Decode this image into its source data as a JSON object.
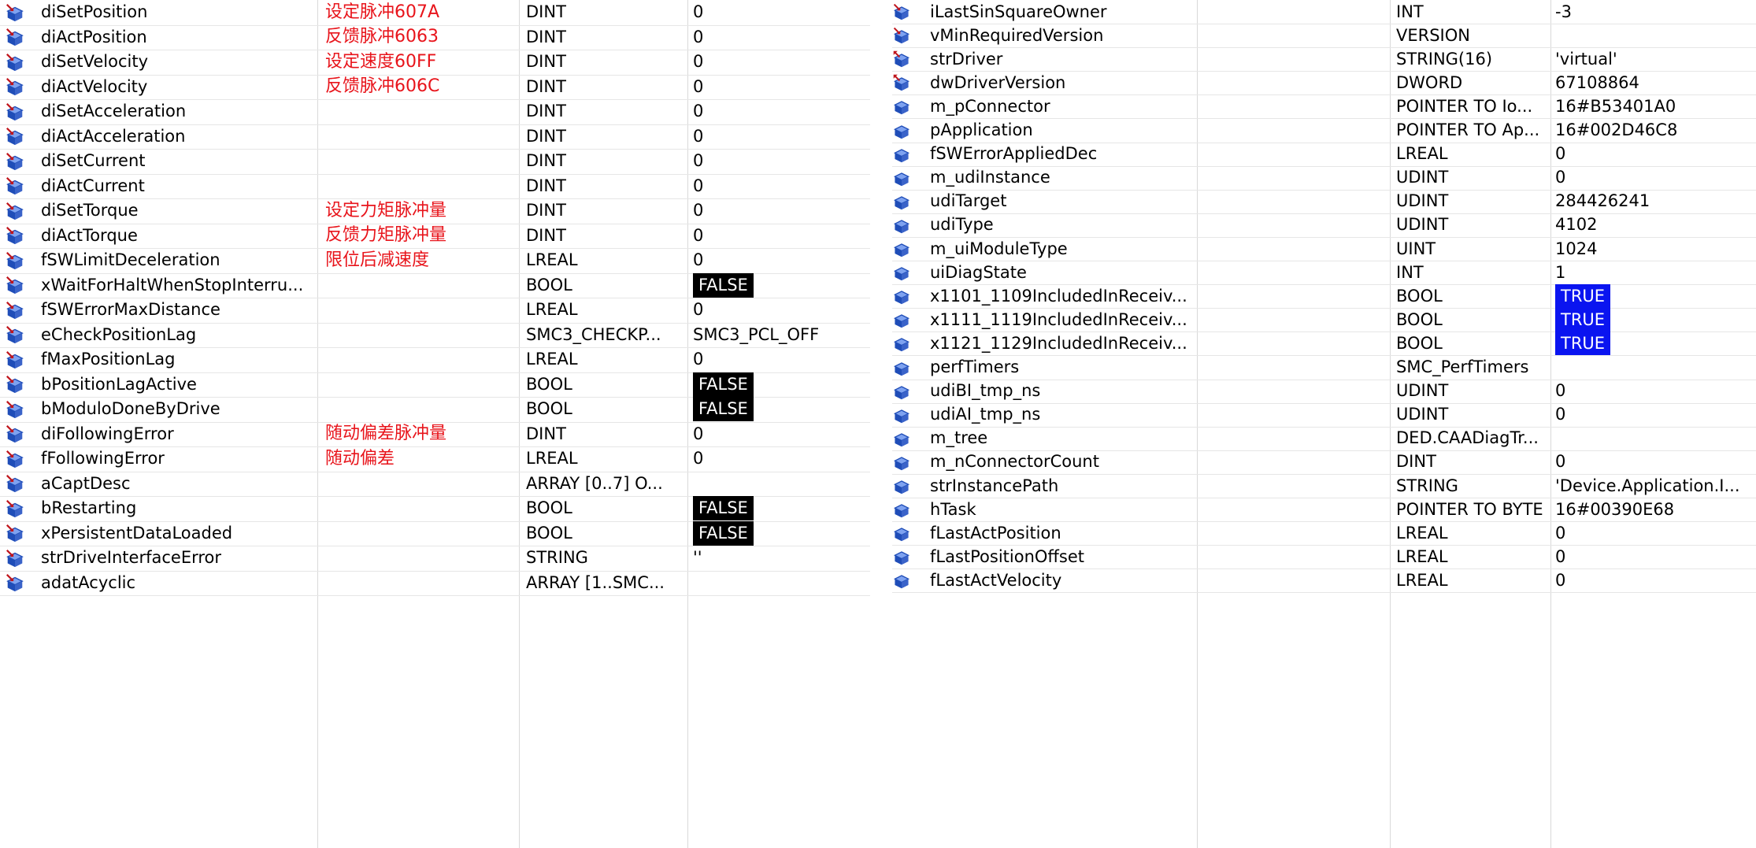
{
  "left_table": {
    "rows": [
      {
        "name": "diSetPosition",
        "note": "设定脉冲607A",
        "type": "DINT",
        "value": "0",
        "icon": "input-var-icon"
      },
      {
        "name": "diActPosition",
        "note": "反馈脉冲6063",
        "type": "DINT",
        "value": "0",
        "icon": "input-var-icon"
      },
      {
        "name": "diSetVelocity",
        "note": "设定速度60FF",
        "type": "DINT",
        "value": "0",
        "icon": "input-var-icon"
      },
      {
        "name": "diActVelocity",
        "note": "反馈脉冲606C",
        "type": "DINT",
        "value": "0",
        "icon": "input-var-icon"
      },
      {
        "name": "diSetAcceleration",
        "note": "",
        "type": "DINT",
        "value": "0",
        "icon": "input-var-icon"
      },
      {
        "name": "diActAcceleration",
        "note": "",
        "type": "DINT",
        "value": "0",
        "icon": "input-var-icon"
      },
      {
        "name": "diSetCurrent",
        "note": "",
        "type": "DINT",
        "value": "0",
        "icon": "input-var-icon"
      },
      {
        "name": "diActCurrent",
        "note": "",
        "type": "DINT",
        "value": "0",
        "icon": "input-var-icon"
      },
      {
        "name": "diSetTorque",
        "note": "设定力矩脉冲量",
        "type": "DINT",
        "value": "0",
        "icon": "input-var-icon"
      },
      {
        "name": "diActTorque",
        "note": "反馈力矩脉冲量",
        "type": "DINT",
        "value": "0",
        "icon": "input-var-icon"
      },
      {
        "name": "fSWLimitDeceleration",
        "note": "限位后减速度",
        "type": "LREAL",
        "value": "0",
        "icon": "input-var-icon"
      },
      {
        "name": "xWaitForHaltWhenStopInterru...",
        "note": "",
        "type": "BOOL",
        "value": "FALSE",
        "badge": "false",
        "icon": "input-var-icon"
      },
      {
        "name": "fSWErrorMaxDistance",
        "note": "",
        "type": "LREAL",
        "value": "0",
        "icon": "input-var-icon"
      },
      {
        "name": "eCheckPositionLag",
        "note": "",
        "type": "SMC3_CHECKP...",
        "value": "SMC3_PCL_OFF",
        "icon": "input-var-icon"
      },
      {
        "name": "fMaxPositionLag",
        "note": "",
        "type": "LREAL",
        "value": "0",
        "icon": "input-var-icon"
      },
      {
        "name": "bPositionLagActive",
        "note": "",
        "type": "BOOL",
        "value": "FALSE",
        "badge": "false",
        "icon": "input-var-icon"
      },
      {
        "name": "bModuloDoneByDrive",
        "note": "",
        "type": "BOOL",
        "value": "FALSE",
        "badge": "false",
        "icon": "input-var-icon"
      },
      {
        "name": "diFollowingError",
        "note": "随动偏差脉冲量",
        "type": "DINT",
        "value": "0",
        "icon": "input-var-icon"
      },
      {
        "name": "fFollowingError",
        "note": "随动偏差",
        "type": "LREAL",
        "value": "0",
        "icon": "input-var-icon"
      },
      {
        "name": "aCaptDesc",
        "note": "",
        "type": "ARRAY [0..7] O...",
        "value": "",
        "icon": "input-var-icon"
      },
      {
        "name": "bRestarting",
        "note": "",
        "type": "BOOL",
        "value": "FALSE",
        "badge": "false",
        "icon": "input-var-icon"
      },
      {
        "name": "xPersistentDataLoaded",
        "note": "",
        "type": "BOOL",
        "value": "FALSE",
        "badge": "false",
        "icon": "input-var-icon"
      },
      {
        "name": "strDriveInterfaceError",
        "note": "",
        "type": "STRING",
        "value": "''",
        "icon": "input-var-icon"
      },
      {
        "name": "adatAcyclic",
        "note": "",
        "type": "ARRAY [1..SMC...",
        "value": "",
        "icon": "input-var-icon"
      }
    ]
  },
  "right_table": {
    "rows": [
      {
        "name": "iLastSinSquareOwner",
        "type": "INT",
        "value": "-3",
        "icon": "input-var-icon"
      },
      {
        "name": "vMinRequiredVersion",
        "type": "VERSION",
        "value": "",
        "icon": "input-var-icon"
      },
      {
        "name": "strDriver",
        "type": "STRING(16)",
        "value": "'virtual'",
        "icon": "output-var-icon"
      },
      {
        "name": "dwDriverVersion",
        "type": "DWORD",
        "value": "67108864",
        "icon": "output-var-icon"
      },
      {
        "name": "m_pConnector",
        "type": "POINTER TO Io...",
        "value": "16#B53401A0",
        "icon": "local-var-icon"
      },
      {
        "name": "pApplication",
        "type": "POINTER TO Ap...",
        "value": "16#002D46C8",
        "icon": "local-var-icon"
      },
      {
        "name": "fSWErrorAppliedDec",
        "type": "LREAL",
        "value": "0",
        "icon": "local-var-icon"
      },
      {
        "name": "m_udiInstance",
        "type": "UDINT",
        "value": "0",
        "icon": "local-var-icon"
      },
      {
        "name": "udiTarget",
        "type": "UDINT",
        "value": "284426241",
        "icon": "local-var-icon"
      },
      {
        "name": "udiType",
        "type": "UDINT",
        "value": "4102",
        "icon": "local-var-icon"
      },
      {
        "name": "m_uiModuleType",
        "type": "UINT",
        "value": "1024",
        "icon": "local-var-icon"
      },
      {
        "name": "uiDiagState",
        "type": "INT",
        "value": "1",
        "icon": "local-var-icon"
      },
      {
        "name": "x1101_1109IncludedInReceiv...",
        "type": "BOOL",
        "value": "TRUE",
        "badge": "true",
        "icon": "local-var-icon"
      },
      {
        "name": "x1111_1119IncludedInReceiv...",
        "type": "BOOL",
        "value": "TRUE",
        "badge": "true",
        "icon": "local-var-icon"
      },
      {
        "name": "x1121_1129IncludedInReceiv...",
        "type": "BOOL",
        "value": "TRUE",
        "badge": "true",
        "icon": "local-var-icon"
      },
      {
        "name": "perfTimers",
        "type": "SMC_PerfTimers",
        "value": "",
        "icon": "local-var-icon"
      },
      {
        "name": "udiBI_tmp_ns",
        "type": "UDINT",
        "value": "0",
        "icon": "local-var-icon"
      },
      {
        "name": "udiAI_tmp_ns",
        "type": "UDINT",
        "value": "0",
        "icon": "local-var-icon"
      },
      {
        "name": "m_tree",
        "type": "DED.CAADiagTr...",
        "value": "",
        "icon": "local-var-icon"
      },
      {
        "name": "m_nConnectorCount",
        "type": "DINT",
        "value": "0",
        "icon": "local-var-icon"
      },
      {
        "name": "strInstancePath",
        "type": "STRING",
        "value": "'Device.Application.I...",
        "icon": "local-var-icon"
      },
      {
        "name": "hTask",
        "type": "POINTER TO BYTE",
        "value": "16#00390E68",
        "icon": "local-var-icon"
      },
      {
        "name": "fLastActPosition",
        "type": "LREAL",
        "value": "0",
        "icon": "local-var-icon"
      },
      {
        "name": "fLastPositionOffset",
        "type": "LREAL",
        "value": "0",
        "icon": "local-var-icon"
      },
      {
        "name": "fLastActVelocity",
        "type": "LREAL",
        "value": "0",
        "icon": "local-var-icon"
      }
    ]
  },
  "colors": {
    "note": "#e8141b",
    "false_badge": "#000000",
    "true_badge": "#0a14f0",
    "icon_blue": "#1f4db8",
    "icon_red": "#c0161d"
  }
}
